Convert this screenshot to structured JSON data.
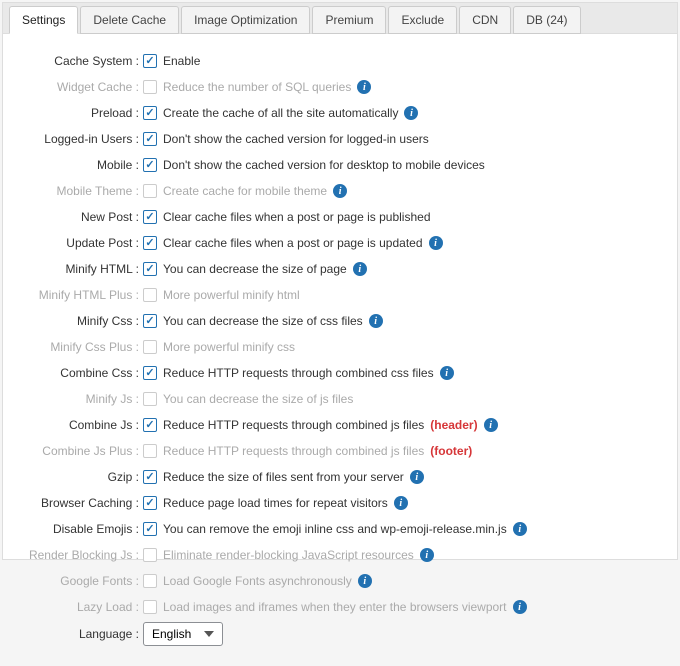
{
  "tabs": [
    {
      "label": "Settings",
      "active": true
    },
    {
      "label": "Delete Cache",
      "active": false
    },
    {
      "label": "Image Optimization",
      "active": false
    },
    {
      "label": "Premium",
      "active": false
    },
    {
      "label": "Exclude",
      "active": false
    },
    {
      "label": "CDN",
      "active": false
    },
    {
      "label": "DB (24)",
      "active": false
    }
  ],
  "settings": [
    {
      "key": "cache_system",
      "label": "Cache System :",
      "desc": "Enable",
      "checked": true,
      "disabled": false,
      "info": false
    },
    {
      "key": "widget_cache",
      "label": "Widget Cache :",
      "desc": "Reduce the number of SQL queries",
      "checked": false,
      "disabled": true,
      "info": true
    },
    {
      "key": "preload",
      "label": "Preload :",
      "desc": "Create the cache of all the site automatically",
      "checked": true,
      "disabled": false,
      "info": true
    },
    {
      "key": "logged_in",
      "label": "Logged-in Users :",
      "desc": "Don't show the cached version for logged-in users",
      "checked": true,
      "disabled": false,
      "info": false
    },
    {
      "key": "mobile",
      "label": "Mobile :",
      "desc": "Don't show the cached version for desktop to mobile devices",
      "checked": true,
      "disabled": false,
      "info": false
    },
    {
      "key": "mobile_theme",
      "label": "Mobile Theme :",
      "desc": "Create cache for mobile theme",
      "checked": false,
      "disabled": true,
      "info": true
    },
    {
      "key": "new_post",
      "label": "New Post :",
      "desc": "Clear cache files when a post or page is published",
      "checked": true,
      "disabled": false,
      "info": false
    },
    {
      "key": "update_post",
      "label": "Update Post :",
      "desc": "Clear cache files when a post or page is updated",
      "checked": true,
      "disabled": false,
      "info": true
    },
    {
      "key": "minify_html",
      "label": "Minify HTML :",
      "desc": "You can decrease the size of page",
      "checked": true,
      "disabled": false,
      "info": true
    },
    {
      "key": "minify_html_p",
      "label": "Minify HTML Plus :",
      "desc": "More powerful minify html",
      "checked": false,
      "disabled": true,
      "info": false
    },
    {
      "key": "minify_css",
      "label": "Minify Css :",
      "desc": "You can decrease the size of css files",
      "checked": true,
      "disabled": false,
      "info": true
    },
    {
      "key": "minify_css_p",
      "label": "Minify Css Plus :",
      "desc": "More powerful minify css",
      "checked": false,
      "disabled": true,
      "info": false
    },
    {
      "key": "combine_css",
      "label": "Combine Css :",
      "desc": "Reduce HTTP requests through combined css files",
      "checked": true,
      "disabled": false,
      "info": true
    },
    {
      "key": "minify_js",
      "label": "Minify Js :",
      "desc": "You can decrease the size of js files",
      "checked": false,
      "disabled": true,
      "info": false
    },
    {
      "key": "combine_js",
      "label": "Combine Js :",
      "desc": "Reduce HTTP requests through combined js files",
      "extra": "(header)",
      "extra_color": "red",
      "checked": true,
      "disabled": false,
      "info": true
    },
    {
      "key": "combine_js_p",
      "label": "Combine Js Plus :",
      "desc": "Reduce HTTP requests through combined js files",
      "extra": "(footer)",
      "extra_color": "red",
      "checked": false,
      "disabled": true,
      "info": false
    },
    {
      "key": "gzip",
      "label": "Gzip :",
      "desc": "Reduce the size of files sent from your server",
      "checked": true,
      "disabled": false,
      "info": true
    },
    {
      "key": "browser_cache",
      "label": "Browser Caching :",
      "desc": "Reduce page load times for repeat visitors",
      "checked": true,
      "disabled": false,
      "info": true
    },
    {
      "key": "disable_emojis",
      "label": "Disable Emojis :",
      "desc": "You can remove the emoji inline css and wp-emoji-release.min.js",
      "checked": true,
      "disabled": false,
      "info": true
    },
    {
      "key": "render_block",
      "label": "Render Blocking Js :",
      "desc": "Eliminate render-blocking JavaScript resources",
      "checked": false,
      "disabled": true,
      "info": true
    },
    {
      "key": "google_fonts",
      "label": "Google Fonts :",
      "desc": "Load Google Fonts asynchronously",
      "checked": false,
      "disabled": true,
      "info": true
    },
    {
      "key": "lazy_load",
      "label": "Lazy Load :",
      "desc": "Load images and iframes when they enter the browsers viewport",
      "checked": false,
      "disabled": true,
      "info": true
    }
  ],
  "language": {
    "label": "Language :",
    "value": "English"
  }
}
